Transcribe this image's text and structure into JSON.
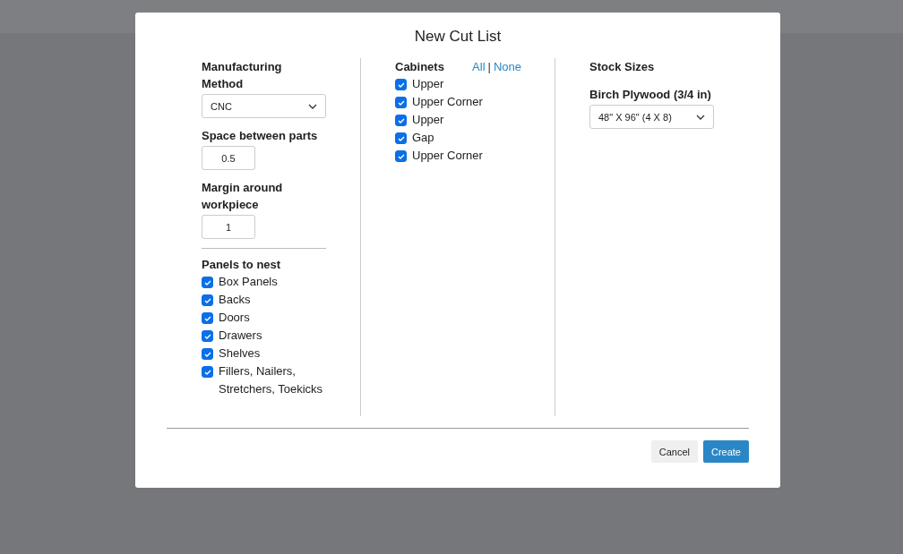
{
  "dialog": {
    "title": "New Cut List",
    "method": {
      "label": "Manufacturing Method",
      "value": "CNC"
    },
    "spacing": {
      "label": "Space between parts",
      "value": "0.5"
    },
    "margin": {
      "label": "Margin around workpiece",
      "value": "1"
    },
    "panels": {
      "label": "Panels to nest",
      "items": [
        {
          "label": "Box Panels",
          "checked": true
        },
        {
          "label": "Backs",
          "checked": true
        },
        {
          "label": "Doors",
          "checked": true
        },
        {
          "label": "Drawers",
          "checked": true
        },
        {
          "label": "Shelves",
          "checked": true
        },
        {
          "label": "Fillers, Nailers, Stretchers, Toekicks",
          "checked": true
        }
      ]
    },
    "cabinets": {
      "label": "Cabinets",
      "all_link": "All",
      "separator": "|",
      "none_link": "None",
      "items": [
        {
          "label": "Upper",
          "checked": true
        },
        {
          "label": "Upper Corner",
          "checked": true
        },
        {
          "label": "Upper",
          "checked": true
        },
        {
          "label": "Gap",
          "checked": true
        },
        {
          "label": "Upper Corner",
          "checked": true
        }
      ]
    },
    "stock": {
      "label": "Stock Sizes",
      "materials": [
        {
          "label": "Birch Plywood (3/4 in)",
          "value": "48\" X 96\" (4 X 8)"
        }
      ]
    },
    "buttons": {
      "cancel": "Cancel",
      "create": "Create"
    }
  }
}
